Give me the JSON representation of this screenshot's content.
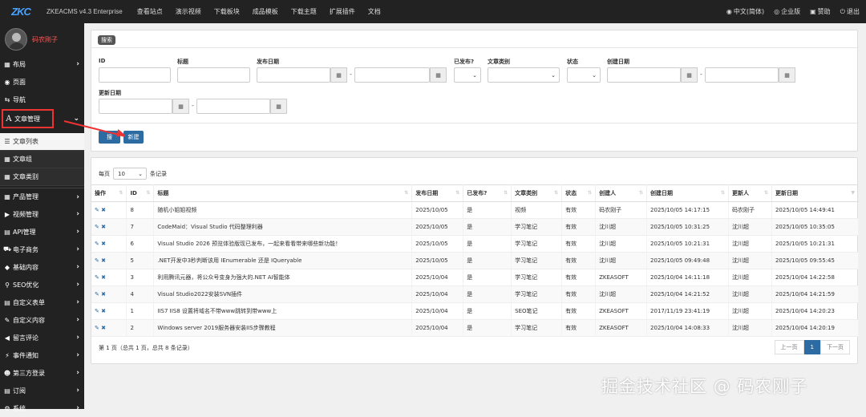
{
  "app": {
    "logo": "ZKC",
    "brand": "ZKEACMS v4.3 Enterprise"
  },
  "topnav": [
    "查看站点",
    "演示视频",
    "下载板块",
    "成品模板",
    "下载主题",
    "扩展插件",
    "文档"
  ],
  "rightnav": {
    "lang": "中文(简体)",
    "edition": "企业版",
    "donate": "赞助",
    "logout": "退出"
  },
  "user": {
    "name": "码农刚子"
  },
  "sidebar": {
    "items_top": [
      {
        "label": "布局",
        "icon": "grid-icon",
        "arrow": true
      },
      {
        "label": "页面",
        "icon": "eye-icon",
        "arrow": false
      },
      {
        "label": "导航",
        "icon": "swap-icon",
        "arrow": false
      }
    ],
    "active": {
      "label": "文章管理",
      "icon": "font-icon"
    },
    "sub": [
      {
        "label": "文章列表",
        "icon": "list-icon"
      },
      {
        "label": "文章组",
        "icon": "grid-icon"
      },
      {
        "label": "文章类别",
        "icon": "grid-icon"
      }
    ],
    "items_bottom": [
      {
        "label": "产品管理",
        "icon": "grid-icon"
      },
      {
        "label": "视频管理",
        "icon": "video-icon"
      },
      {
        "label": "API管理",
        "icon": "file-icon"
      },
      {
        "label": "电子商务",
        "icon": "cart-icon"
      },
      {
        "label": "基础内容",
        "icon": "diamond-icon"
      },
      {
        "label": "SEO优化",
        "icon": "search-icon"
      },
      {
        "label": "自定义表单",
        "icon": "table-icon"
      },
      {
        "label": "自定义内容",
        "icon": "edit-icon"
      },
      {
        "label": "留言评论",
        "icon": "speaker-icon"
      },
      {
        "label": "事件通知",
        "icon": "bolt-icon"
      },
      {
        "label": "第三方登录",
        "icon": "user-icon"
      },
      {
        "label": "订阅",
        "icon": "table-icon"
      },
      {
        "label": "系统",
        "icon": "gear-icon"
      }
    ]
  },
  "search": {
    "tag": "搜索",
    "labels": {
      "id": "ID",
      "title": "标题",
      "publish_date": "发布日期",
      "published": "已发布?",
      "category": "文章类别",
      "status": "状态",
      "create_date": "创建日期",
      "update_date": "更新日期"
    },
    "dash": "-",
    "btn_search": "搜",
    "btn_new": "新建"
  },
  "list": {
    "per_page_label": "每页",
    "per_page_value": "10",
    "per_page_suffix": "条记录",
    "headers": [
      "操作",
      "ID",
      "标题",
      "发布日期",
      "已发布?",
      "文章类别",
      "状态",
      "创建人",
      "创建日期",
      "更新人",
      "更新日期"
    ],
    "rows": [
      [
        "8",
        "随机小姐姐视频",
        "2025/10/05",
        "是",
        "视频",
        "有效",
        "码农刚子",
        "2025/10/05 14:17:15",
        "码农刚子",
        "2025/10/05 14:49:41"
      ],
      [
        "7",
        "CodeMaid：Visual Studio 代码整理利器",
        "2025/10/05",
        "是",
        "学习笔记",
        "有效",
        "沈川超",
        "2025/10/05 10:31:25",
        "沈川超",
        "2025/10/05 10:35:05"
      ],
      [
        "6",
        "Visual Studio 2026 预览体验版现已发布，一起来看看带来哪些新功能！",
        "2025/10/05",
        "是",
        "学习笔记",
        "有效",
        "沈川超",
        "2025/10/05 10:21:31",
        "沈川超",
        "2025/10/05 10:21:31"
      ],
      [
        "5",
        ".NET开发中3秒判断该用 IEnumerable 还是 IQueryable",
        "2025/10/05",
        "是",
        "学习笔记",
        "有效",
        "沈川超",
        "2025/10/05 09:49:48",
        "沈川超",
        "2025/10/05 09:55:45"
      ],
      [
        "3",
        "利用腾讯元器，将公众号变身为强大的.NET AI智能体",
        "2025/10/04",
        "是",
        "学习笔记",
        "有效",
        "ZKEASOFT",
        "2025/10/04 14:11:18",
        "沈川超",
        "2025/10/04 14:22:58"
      ],
      [
        "4",
        "Visual Studio2022安装SVN插件",
        "2025/10/04",
        "是",
        "学习笔记",
        "有效",
        "沈川超",
        "2025/10/04 14:21:52",
        "沈川超",
        "2025/10/04 14:21:59"
      ],
      [
        "1",
        "IIS7 IIS8 设置将域名不带www跳转到带www上",
        "2025/10/04",
        "是",
        "SEO笔记",
        "有效",
        "ZKEASOFT",
        "2017/11/19 23:41:19",
        "沈川超",
        "2025/10/04 14:20:23"
      ],
      [
        "2",
        "Windows server 2019服务器安装IIS步骤教程",
        "2025/10/04",
        "是",
        "学习笔记",
        "有效",
        "ZKEASOFT",
        "2025/10/04 14:08:33",
        "沈川超",
        "2025/10/04 14:20:19"
      ]
    ],
    "page_info": "第 1 页（总共 1 页，总共 8 条记录）",
    "prev": "上一页",
    "current": "1",
    "next": "下一页"
  },
  "watermark": "掘金技术社区 @ 码农刚子"
}
